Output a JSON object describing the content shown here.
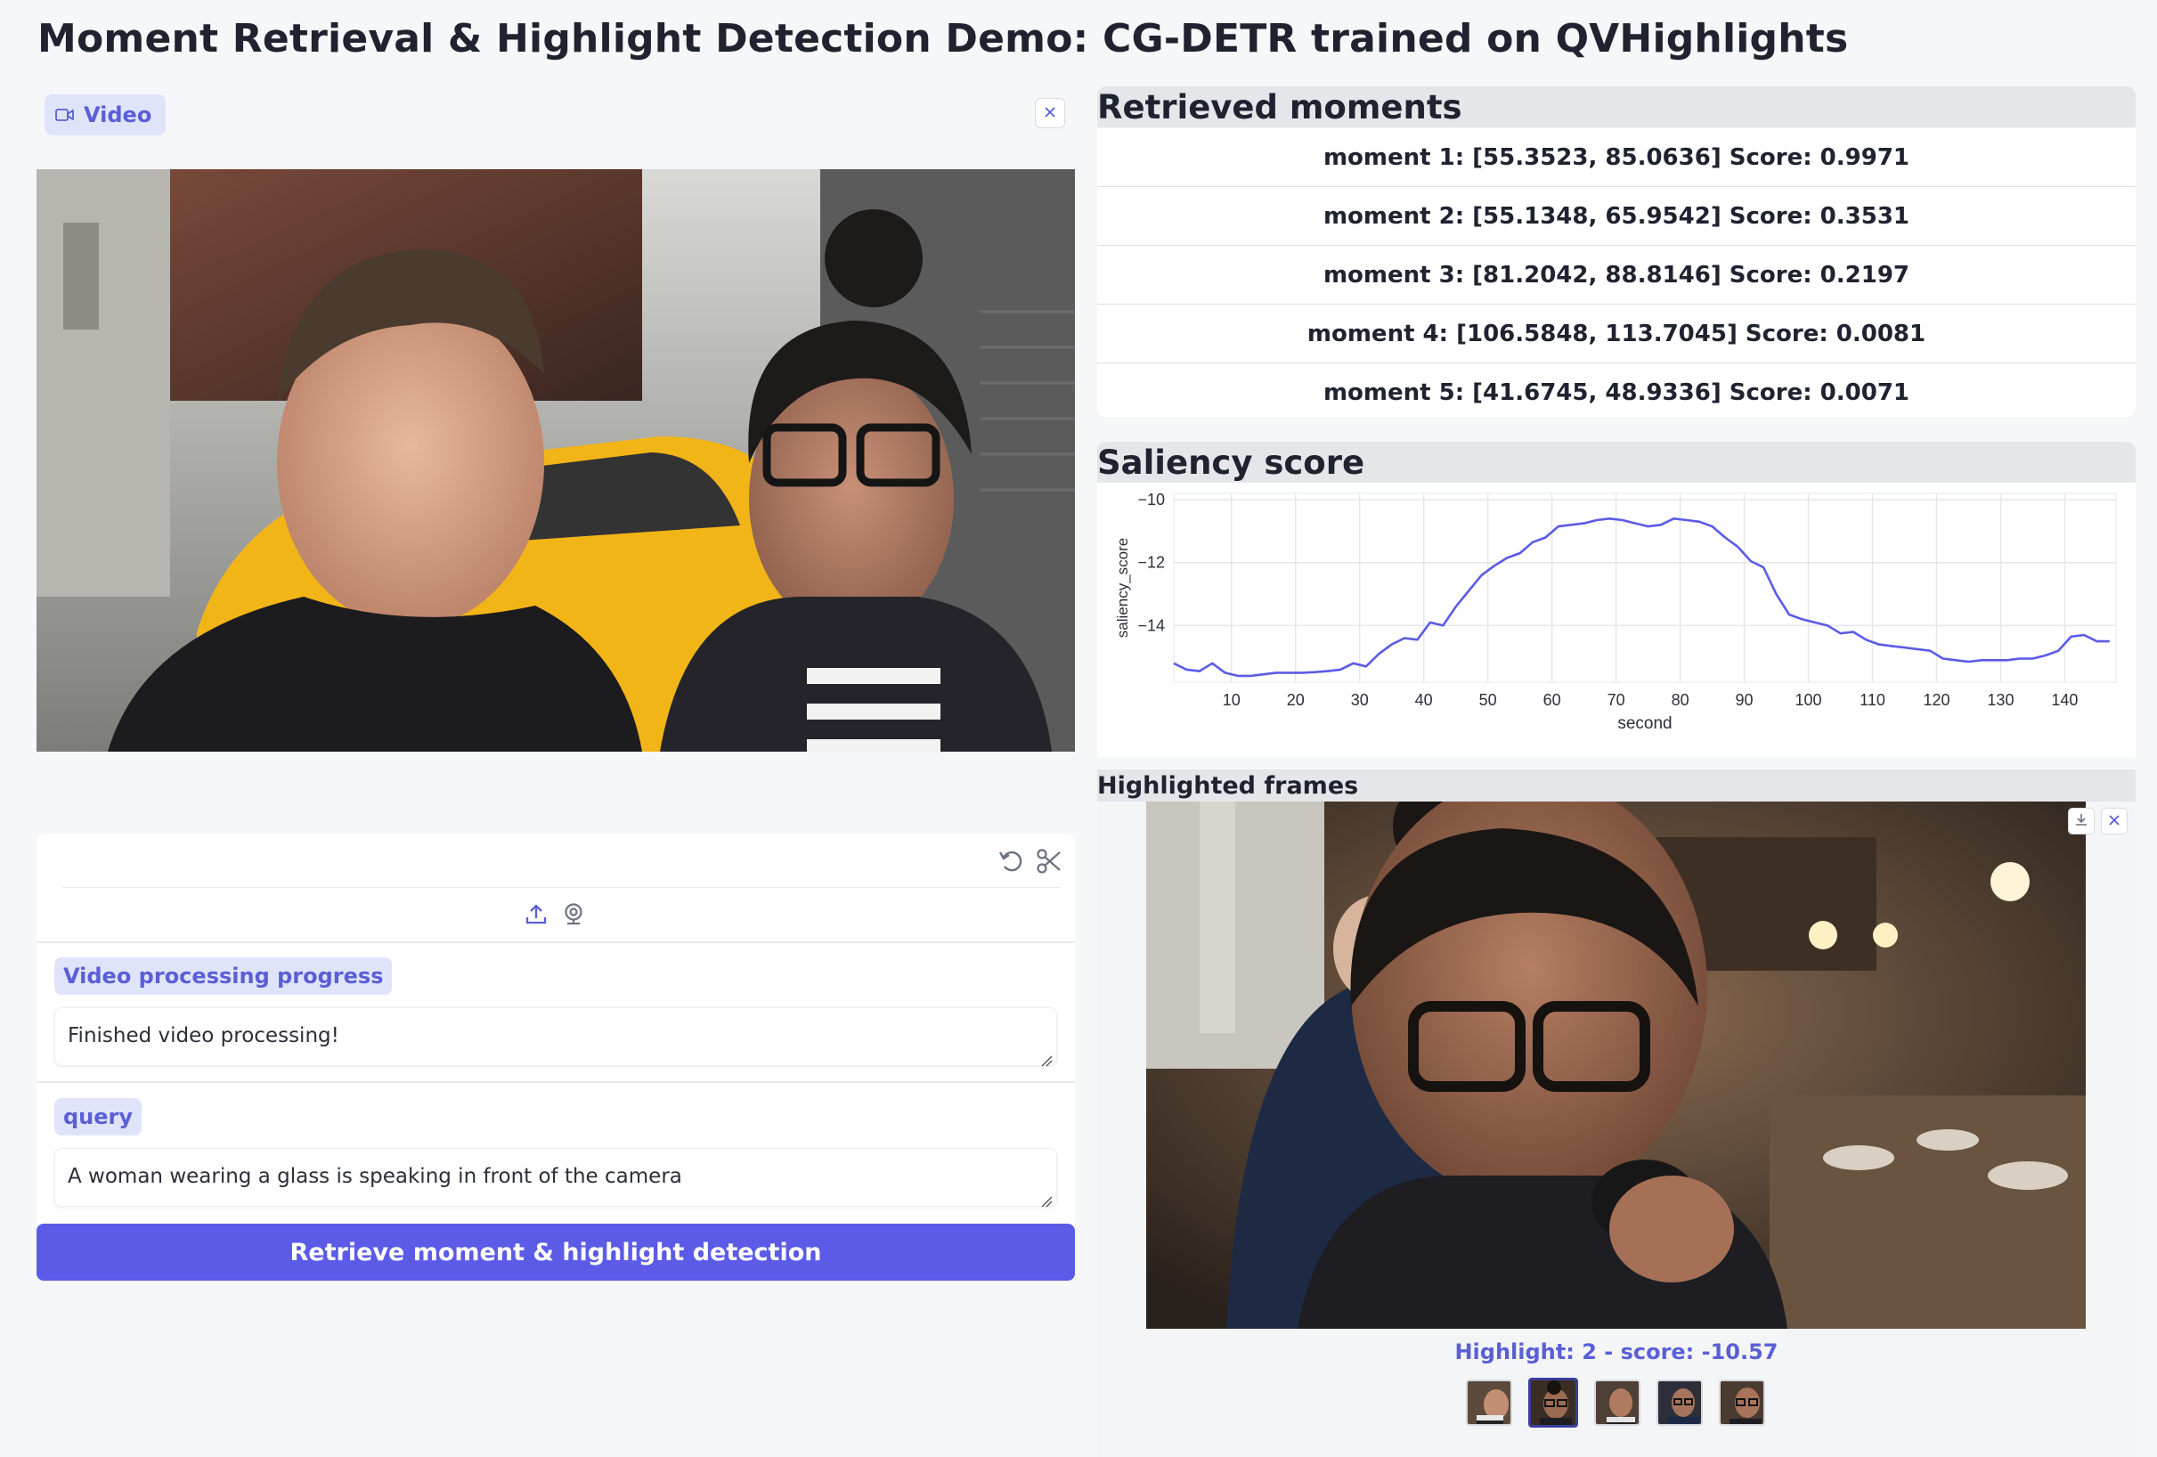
{
  "page": {
    "title": "Moment Retrieval & Highlight Detection Demo: CG-DETR trained on QVHighlights"
  },
  "video_input": {
    "label": "Video",
    "icon": "video-camera-icon",
    "close_icon": "close-icon"
  },
  "editor_toolbar": {
    "undo_icon": "undo-icon",
    "trim_icon": "scissors-icon",
    "upload_icon": "upload-icon",
    "webcam_icon": "webcam-icon"
  },
  "progress": {
    "label": "Video processing progress",
    "value": "Finished video processing!"
  },
  "query": {
    "label": "query",
    "value": "A woman wearing a glass is speaking in front of the camera"
  },
  "submit": {
    "label": "Retrieve moment & highlight detection"
  },
  "moments": {
    "header": "Retrieved moments",
    "rows": [
      "moment 1: [55.3523, 85.0636] Score: 0.9971",
      "moment 2: [55.1348, 65.9542] Score: 0.3531",
      "moment 3: [81.2042, 88.8146] Score: 0.2197",
      "moment 4: [106.5848, 113.7045] Score: 0.0081",
      "moment 5: [41.6745, 48.9336] Score: 0.0071"
    ]
  },
  "saliency": {
    "header": "Saliency score"
  },
  "chart_data": {
    "type": "line",
    "title": "",
    "xlabel": "second",
    "ylabel": "saliency_score",
    "xlim": [
      1,
      148
    ],
    "ylim": [
      -15.8,
      -9.8
    ],
    "x_ticks": [
      10,
      20,
      30,
      40,
      50,
      60,
      70,
      80,
      90,
      100,
      110,
      120,
      130,
      140
    ],
    "y_ticks": [
      -10,
      -12,
      -14
    ],
    "grid": true,
    "color": "#5b5be8",
    "series": [
      {
        "x": [
          1,
          3,
          5,
          7,
          9,
          11,
          13,
          15,
          17,
          19,
          21,
          23,
          25,
          27,
          29,
          31,
          33,
          35,
          37,
          39,
          41,
          43,
          45,
          47,
          49,
          51,
          53,
          55,
          57,
          59,
          61,
          63,
          65,
          67,
          69,
          71,
          73,
          75,
          77,
          79,
          81,
          83,
          85,
          87,
          89,
          91,
          93,
          95,
          97,
          99,
          101,
          103,
          105,
          107,
          109,
          111,
          113,
          115,
          117,
          119,
          121,
          123,
          125,
          127,
          129,
          131,
          133,
          135,
          137,
          139,
          141,
          143,
          145,
          147
        ],
        "values": [
          -15.2,
          -15.4,
          -15.45,
          -15.2,
          -15.5,
          -15.6,
          -15.6,
          -15.55,
          -15.5,
          -15.5,
          -15.5,
          -15.48,
          -15.45,
          -15.4,
          -15.2,
          -15.3,
          -14.9,
          -14.6,
          -14.4,
          -14.45,
          -13.9,
          -14.0,
          -13.4,
          -12.9,
          -12.4,
          -12.1,
          -11.85,
          -11.7,
          -11.35,
          -11.2,
          -10.85,
          -10.8,
          -10.75,
          -10.65,
          -10.6,
          -10.65,
          -10.75,
          -10.85,
          -10.8,
          -10.6,
          -10.65,
          -10.7,
          -10.85,
          -11.2,
          -11.5,
          -11.95,
          -12.15,
          -13.0,
          -13.65,
          -13.8,
          -13.9,
          -14.0,
          -14.25,
          -14.2,
          -14.45,
          -14.6,
          -14.65,
          -14.7,
          -14.75,
          -14.8,
          -15.05,
          -15.1,
          -15.15,
          -15.1,
          -15.1,
          -15.1,
          -15.05,
          -15.05,
          -14.95,
          -14.8,
          -14.35,
          -14.3,
          -14.5,
          -14.5
        ]
      }
    ]
  },
  "highlights": {
    "header": "Highlighted frames",
    "caption": "Highlight: 2 - score: -10.57",
    "download_icon": "download-icon",
    "close_icon": "close-icon",
    "thumbnail_count": 5,
    "selected_index": 1
  }
}
